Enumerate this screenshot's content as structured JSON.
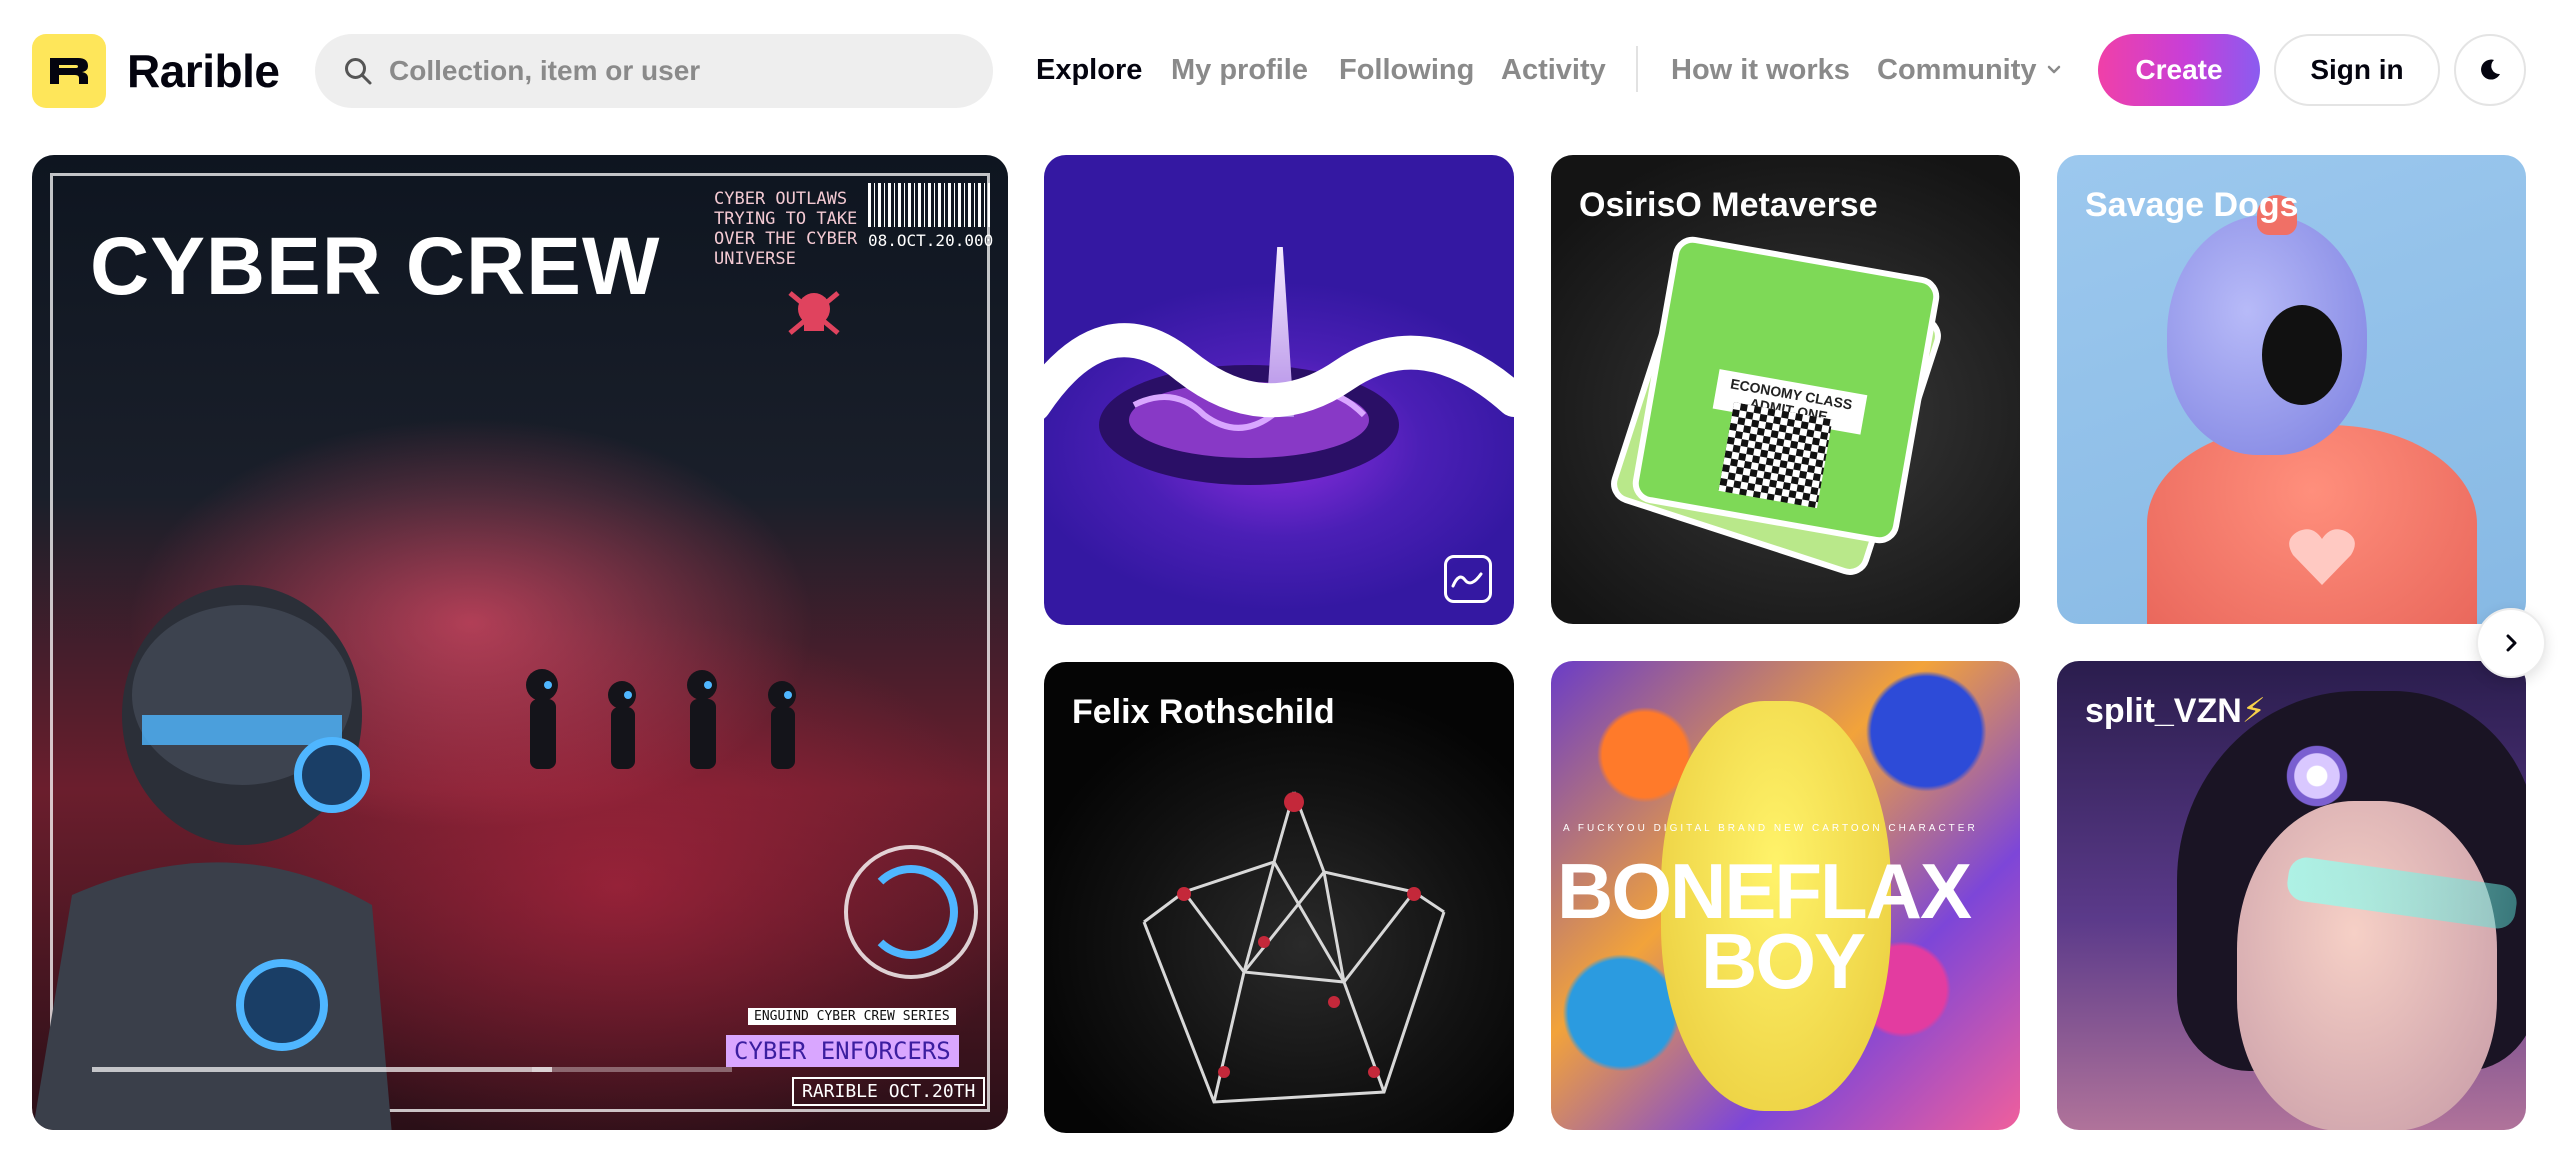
{
  "app": {
    "name": "Rarible"
  },
  "search": {
    "placeholder": "Collection, item or user"
  },
  "nav": {
    "explore": "Explore",
    "my_profile": "My profile",
    "following": "Following",
    "activity": "Activity",
    "how_it_works": "How it works",
    "community": "Community"
  },
  "actions": {
    "create": "Create",
    "sign_in": "Sign in"
  },
  "colors": {
    "brand_yellow": "#fee65a",
    "create_gradient_start": "#f040a8",
    "create_gradient_end": "#8a5cf0"
  },
  "icons": {
    "search": "search-icon",
    "chevron": "chevron-down-icon",
    "theme": "moon-icon",
    "next": "chevron-right-icon",
    "chart": "chart-icon"
  },
  "hero": {
    "title": "CYBER CREW",
    "top_text": "CYBER OUTLAWS TRYING TO TAKE OVER THE CYBER UNIVERSE",
    "date": "08.OCT.20.000",
    "series": "ENGUIND CYBER CREW SERIES",
    "subtitle": "CYBER ENFORCERS",
    "release": "RARIBLE OCT.20TH"
  },
  "collections": [
    {
      "title": ""
    },
    {
      "title": "OsirisO Metaverse",
      "ticket_label": "ECONOMY CLASS ADMIT ONE"
    },
    {
      "title": "Savage Dogs"
    },
    {
      "title": "Felix Rothschild"
    },
    {
      "title": "",
      "art_small": "A FUCKYOU DIGITAL BRAND NEW CARTOON CHARACTER",
      "art_line1": "BONEFLAX",
      "art_line2": "BOY"
    },
    {
      "title": "split_VZN",
      "title_suffix": "⚡"
    }
  ]
}
